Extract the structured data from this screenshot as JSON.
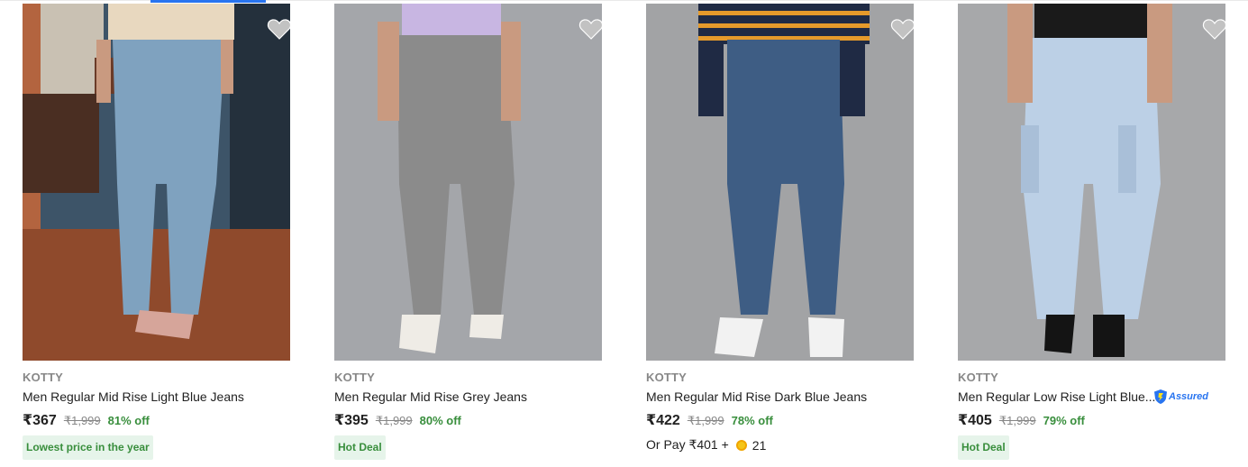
{
  "colors": {
    "accent": "#2874f0",
    "offer_green": "#388e3c",
    "tag_bg": "#e6f4ea",
    "muted": "#878787"
  },
  "products": [
    {
      "brand": "KOTTY",
      "title": "Men Regular Mid Rise Light Blue Jeans",
      "price": "₹367",
      "mrp": "₹1,999",
      "discount": "81% off",
      "tag": "Lowest price in the year",
      "wishlist_icon": "heart-icon"
    },
    {
      "brand": "KOTTY",
      "title": "Men Regular Mid Rise Grey Jeans",
      "price": "₹395",
      "mrp": "₹1,999",
      "discount": "80% off",
      "tag": "Hot Deal",
      "wishlist_icon": "heart-icon"
    },
    {
      "brand": "KOTTY",
      "title": "Men Regular Mid Rise Dark Blue Jeans",
      "price": "₹422",
      "mrp": "₹1,999",
      "discount": "78% off",
      "or_pay": "Or Pay ₹401 +",
      "coins": "21",
      "wishlist_icon": "heart-icon"
    },
    {
      "brand": "KOTTY",
      "title": "Men Regular Low Rise Light Blue...",
      "price": "₹405",
      "mrp": "₹1,999",
      "discount": "79% off",
      "tag": "Hot Deal",
      "assured_label": "Assured",
      "wishlist_icon": "heart-icon"
    }
  ]
}
